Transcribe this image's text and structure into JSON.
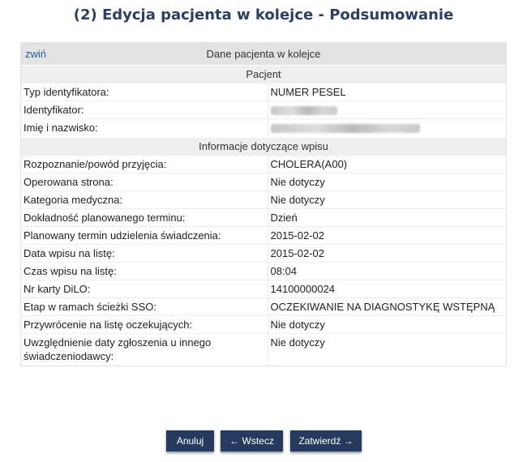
{
  "page": {
    "title": "(2) Edycja pacjenta w kolejce - Podsumowanie"
  },
  "panel": {
    "collapse_label": "zwiń",
    "title": "Dane pacjenta w kolejce"
  },
  "patient": {
    "section_title": "Pacjent",
    "rows": [
      {
        "label": "Typ identyfikatora:",
        "value": "NUMER PESEL"
      },
      {
        "label": "Identyfikator:",
        "value": ""
      },
      {
        "label": "Imię i nazwisko:",
        "value": ""
      }
    ]
  },
  "entry": {
    "section_title": "Informacje dotyczące wpisu",
    "rows": [
      {
        "label": "Rozpoznanie/powód przyjęcia:",
        "value": "CHOLERA(A00)"
      },
      {
        "label": "Operowana strona:",
        "value": "Nie dotyczy"
      },
      {
        "label": "Kategoria medyczna:",
        "value": "Nie dotyczy"
      },
      {
        "label": "Dokładność planowanego terminu:",
        "value": "Dzień"
      },
      {
        "label": "Planowany termin udzielenia świadczenia:",
        "value": "2015-02-02"
      },
      {
        "label": "Data wpisu na listę:",
        "value": "2015-02-02"
      },
      {
        "label": "Czas wpisu na listę:",
        "value": "08:04"
      },
      {
        "label": "Nr karty DiLO:",
        "value": "14100000024"
      },
      {
        "label": "Etap w ramach ścieżki SSO:",
        "value": "OCZEKIWANIE NA DIAGNOSTYKĘ WSTĘPNĄ"
      },
      {
        "label": "Przywrócenie na listę oczekujących:",
        "value": "Nie dotyczy"
      },
      {
        "label": "Uwzględnienie daty zgłoszenia u innego świadczeniodawcy:",
        "value": "Nie dotyczy"
      }
    ]
  },
  "buttons": {
    "cancel": "Anuluj",
    "back": "← Wstecz",
    "confirm": "Zatwierdź →"
  }
}
